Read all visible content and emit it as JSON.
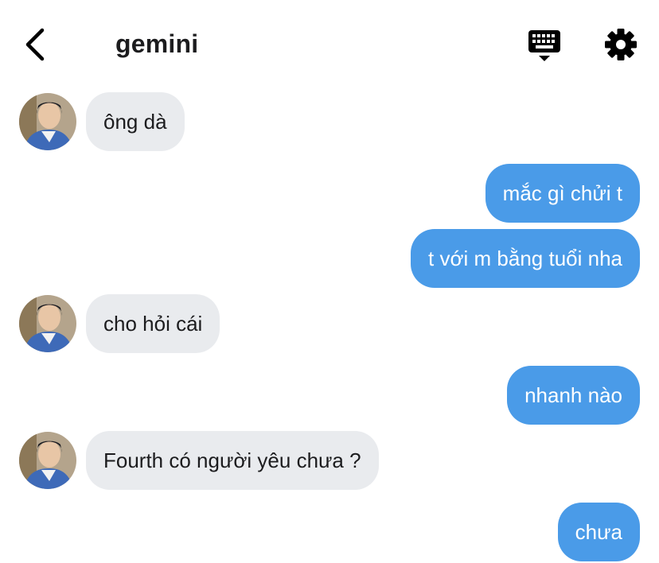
{
  "header": {
    "title": "gemini",
    "back_icon": "chevron-left-icon",
    "keyboard_icon": "keyboard-icon",
    "settings_icon": "gear-icon"
  },
  "colors": {
    "incoming_bubble": "#e9ebee",
    "outgoing_bubble": "#4a9be8",
    "incoming_text": "#1c1c1e",
    "outgoing_text": "#ffffff"
  },
  "messages": [
    {
      "from": "them",
      "text": "ông dà"
    },
    {
      "from": "me",
      "text": "mắc gì chửi t"
    },
    {
      "from": "me",
      "text": "t với m bằng tuổi nha"
    },
    {
      "from": "them",
      "text": "cho hỏi cái"
    },
    {
      "from": "me",
      "text": "nhanh nào"
    },
    {
      "from": "them",
      "text": "Fourth có người yêu chưa ?"
    },
    {
      "from": "me",
      "text": "chưa"
    }
  ]
}
